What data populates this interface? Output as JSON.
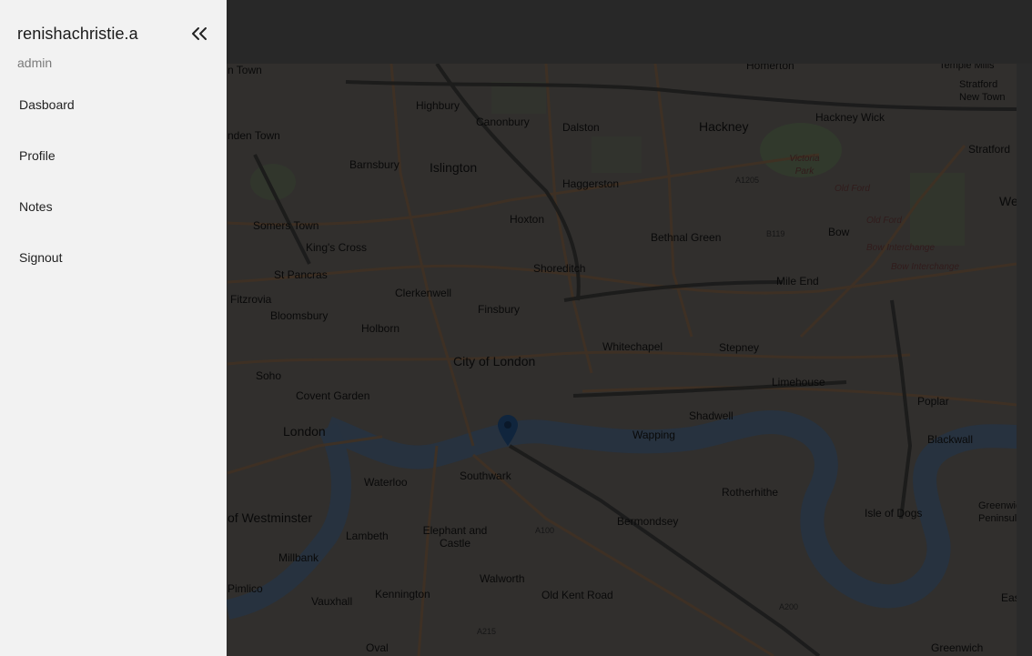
{
  "drawer": {
    "username": "renishachristie.a",
    "role": "admin",
    "collapse_icon": "double-chevron-left-icon",
    "items": [
      {
        "label": "Dasboard"
      },
      {
        "label": "Profile"
      },
      {
        "label": "Notes"
      },
      {
        "label": "Signout"
      }
    ]
  },
  "map": {
    "marker_icon": "map-pin-icon",
    "labels": {
      "homerton": "Homerton",
      "templemills": "Temple Mills",
      "stratford_new_town": "Stratford New Town",
      "ntown": "n Town",
      "highbury": "Highbury",
      "canonbury": "Canonbury",
      "dalston": "Dalston",
      "hackney": "Hackney",
      "hackney_wick": "Hackney Wick",
      "stratford": "Stratford",
      "camden_town": "nden Town",
      "barnsbury": "Barnsbury",
      "islington": "Islington",
      "victoria_park": "Victoria Park",
      "old_ford": "Old Ford",
      "haggerston": "Haggerston",
      "we": "We",
      "somers_town": "Somers Town",
      "hoxton": "Hoxton",
      "kings_cross": "King's Cross",
      "bethnal_green": "Bethnal Green",
      "bow": "Bow",
      "bow_interchange_1": "Bow Interchange",
      "bow_interchange_2": "Bow Interchange",
      "old_ford_2": "Old Ford",
      "st_pancras": "St Pancras",
      "shoreditch": "Shoreditch",
      "fitzrovia": "Fitzrovia",
      "clerkenwell": "Clerkenwell",
      "mile_end": "Mile End",
      "bloomsbury": "Bloomsbury",
      "finsbury": "Finsbury",
      "holborn": "Holborn",
      "whitechapel": "Whitechapel",
      "stepney": "Stepney",
      "city_of_london": "City of London",
      "soho": "Soho",
      "limehouse": "Limehouse",
      "covent_garden": "Covent Garden",
      "poplar": "Poplar",
      "shadwell": "Shadwell",
      "london": "London",
      "wapping": "Wapping",
      "blackwall": "Blackwall",
      "southwark": "Southwark",
      "waterloo": "Waterloo",
      "rotherhithe": "Rotherhithe",
      "greenwich_pen": "Greenwich Peninsula",
      "of_westminster": "of Westminster",
      "isle_of_dogs": "Isle of Dogs",
      "lambeth": "Lambeth",
      "elephant_and_castle": "Elephant and Castle",
      "bermondsey": "Bermondsey",
      "millbank": "Millbank",
      "walworth": "Walworth",
      "pimlico": "Pimlico",
      "kennington": "Kennington",
      "old_kent_road": "Old Kent Road",
      "vauxhall": "Vauxhall",
      "eas": "Eas",
      "oval": "Oval",
      "greenwich": "Greenwich",
      "a1205": "A1205",
      "b119": "B119",
      "a100": "A100",
      "a200": "A200",
      "a215": "A215"
    }
  },
  "colors": {
    "drawer_bg": "#f2f2f2",
    "backdrop": "#303030"
  }
}
